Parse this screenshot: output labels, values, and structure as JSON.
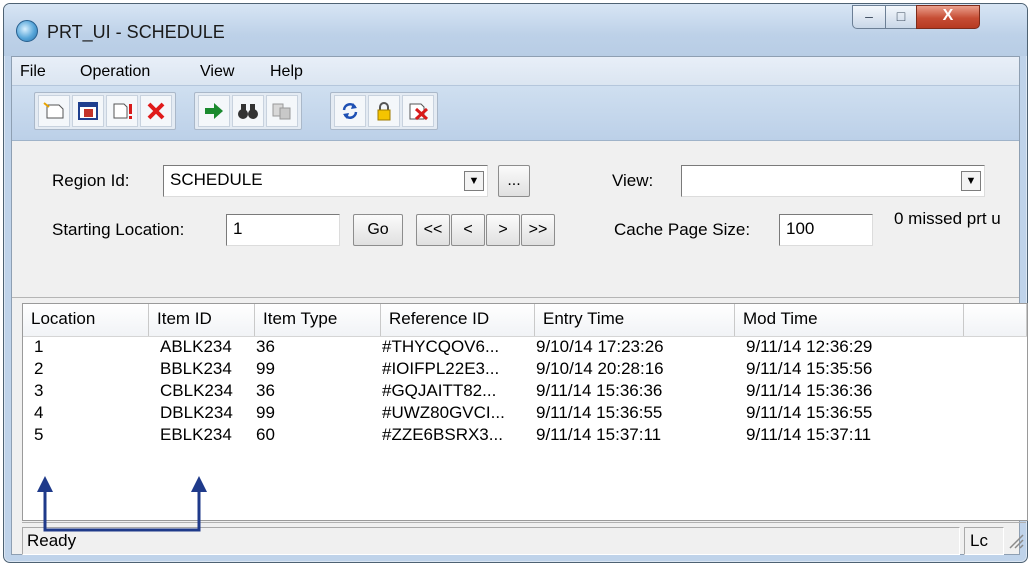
{
  "window": {
    "title": "PRT_UI - SCHEDULE",
    "minimize_glyph": "–",
    "maximize_glyph": "□",
    "close_glyph": "X"
  },
  "menu": [
    "File",
    "Operation",
    "View",
    "Help"
  ],
  "toolbar": {
    "groups": [
      [
        {
          "icon": "new-icon"
        },
        {
          "icon": "calendar-icon"
        },
        {
          "icon": "alert-document-icon"
        },
        {
          "icon": "delete-icon"
        }
      ],
      [
        {
          "icon": "arrow-right-icon"
        },
        {
          "icon": "binoculars-icon"
        },
        {
          "icon": "find-replace-icon"
        }
      ],
      [
        {
          "icon": "refresh-icon"
        },
        {
          "icon": "lock-icon"
        },
        {
          "icon": "cancel-document-icon"
        }
      ]
    ]
  },
  "params": {
    "region_label": "Region Id:",
    "region_value": "SCHEDULE",
    "browse_label": "...",
    "view_label": "View:",
    "view_value": "",
    "start_label": "Starting Location:",
    "start_value": "1",
    "go_label": "Go",
    "nav": {
      "first": "<<",
      "prev": "<",
      "next": ">",
      "last": ">>"
    },
    "cache_label": "Cache Page Size:",
    "cache_value": "100",
    "missed_text": "0 missed prt u"
  },
  "table": {
    "columns": [
      "Location",
      "Item ID",
      "Item Type",
      "Reference ID",
      "Entry Time",
      "Mod Time"
    ],
    "rows": [
      [
        "1",
        "ABLK234",
        "36",
        "#THYCQOV6...",
        "9/10/14 17:23:26",
        "9/11/14 12:36:29"
      ],
      [
        "2",
        "BBLK234",
        "99",
        "#IOIFPL22E3...",
        "9/10/14 20:28:16",
        "9/11/14 15:35:56"
      ],
      [
        "3",
        "CBLK234",
        "36",
        "#GQJAITT82...",
        "9/11/14 15:36:36",
        "9/11/14 15:36:36"
      ],
      [
        "4",
        "DBLK234",
        "99",
        "#UWZ80GVCI...",
        "9/11/14 15:36:55",
        "9/11/14 15:36:55"
      ],
      [
        "5",
        "EBLK234",
        "60",
        "#ZZE6BSRX3...",
        "9/11/14 15:37:11",
        "9/11/14 15:37:11"
      ]
    ]
  },
  "status": {
    "text": "Ready",
    "side": "Lc"
  },
  "colors": {
    "annotation_arrow": "#1f3a8a",
    "title_gradient": "#bdd1e8",
    "close_button": "#c64d34"
  }
}
